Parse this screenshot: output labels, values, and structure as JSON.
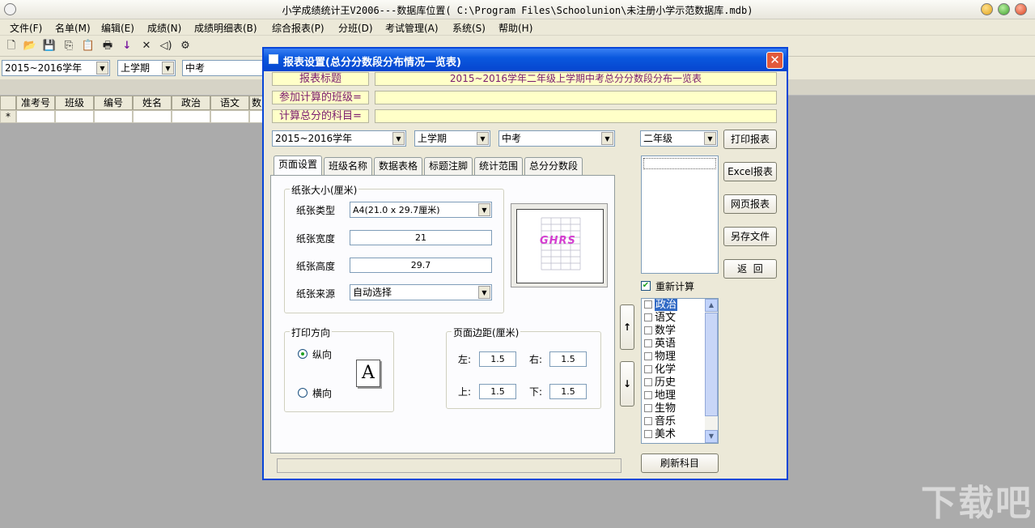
{
  "window": {
    "title": "小学成绩统计王V2006---数据库位置( C:\\Program Files\\Schoolunion\\未注册小学示范数据库.mdb)"
  },
  "menu": [
    "文件(F)",
    "名单(M)",
    "编辑(E)",
    "成绩(N)",
    "成绩明细表(B)",
    "综合报表(P)",
    "分班(D)",
    "考试管理(A)",
    "系统(S)",
    "帮助(H)"
  ],
  "toolbar_icons": [
    "new-icon",
    "open-icon",
    "save-icon",
    "copy-icon",
    "paste-icon",
    "print-icon",
    "arrow-down-icon",
    "delete-icon",
    "speaker-icon",
    "settings-icon"
  ],
  "filters": {
    "year": "2015~2016学年",
    "term": "上学期",
    "exam": "中考"
  },
  "grid": {
    "columns": [
      "准考号",
      "班级",
      "编号",
      "姓名",
      "政治",
      "语文",
      "数"
    ],
    "new_row_marker": "*"
  },
  "dialog": {
    "title": "报表设置(总分分数段分布情况一览表)",
    "close_label": "✕",
    "report_title_label": "报表标题",
    "report_title_value": "2015~2016学年二年级上学期中考总分分数段分布一览表",
    "classes_label": "参加计算的班级=",
    "classes_value": "",
    "subjects_label": "计算总分的科目=",
    "subjects_value": "",
    "year": "2015~2016学年",
    "term": "上学期",
    "exam": "中考",
    "grade": "二年级",
    "tabs": [
      "页面设置",
      "班级名称",
      "数据表格",
      "标题注脚",
      "统计范围",
      "总分分数段"
    ],
    "active_tab": "页面设置",
    "paper_group": "纸张大小(厘米)",
    "paper_type_label": "纸张类型",
    "paper_type_value": "A4(21.0 x 29.7厘米)",
    "paper_width_label": "纸张宽度",
    "paper_width_value": "21",
    "paper_height_label": "纸张高度",
    "paper_height_value": "29.7",
    "paper_source_label": "纸张来源",
    "paper_source_value": "自动选择",
    "preview_logo": "GHRS",
    "orientation_group": "打印方向",
    "portrait_label": "纵向",
    "landscape_label": "横向",
    "orientation_selected": "portrait",
    "orientation_glyph": "A",
    "margin_group": "页面边距(厘米)",
    "margin_left_label": "左:",
    "margin_left": "1.5",
    "margin_right_label": "右:",
    "margin_right": "1.5",
    "margin_top_label": "上:",
    "margin_top": "1.5",
    "margin_bottom_label": "下:",
    "margin_bottom": "1.5",
    "buttons": {
      "print": "打印报表",
      "excel": "Excel报表",
      "web": "网页报表",
      "save_as": "另存文件",
      "back": "返  回",
      "refresh": "刷新科目",
      "up": "↑",
      "down": "↓"
    },
    "recalc_label": "重新计算",
    "recalc_checked": true,
    "subjects": [
      "政治",
      "语文",
      "数学",
      "英语",
      "物理",
      "化学",
      "历史",
      "地理",
      "生物",
      "音乐",
      "美术"
    ],
    "selected_subject": "政治"
  },
  "watermark": "下载吧"
}
